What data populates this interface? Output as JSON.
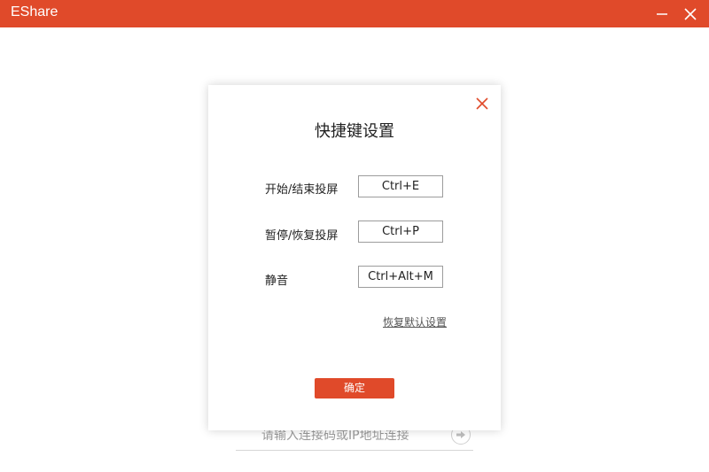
{
  "window": {
    "title": "EShare"
  },
  "connect": {
    "placeholder": "请输入连接码或IP地址连接"
  },
  "dialog": {
    "title": "快捷键设置",
    "rows": [
      {
        "label": "开始/结束投屏",
        "value": "Ctrl+E"
      },
      {
        "label": "暂停/恢复投屏",
        "value": "Ctrl+P"
      },
      {
        "label": "静音",
        "value": "Ctrl+Alt+M"
      }
    ],
    "reset_label": "恢复默认设置",
    "ok_label": "确定"
  },
  "colors": {
    "accent": "#e04a2a"
  },
  "icons": {
    "minimize": "minimize-icon",
    "close": "close-icon",
    "dialog_close": "close-icon",
    "go": "arrow-right-icon"
  }
}
